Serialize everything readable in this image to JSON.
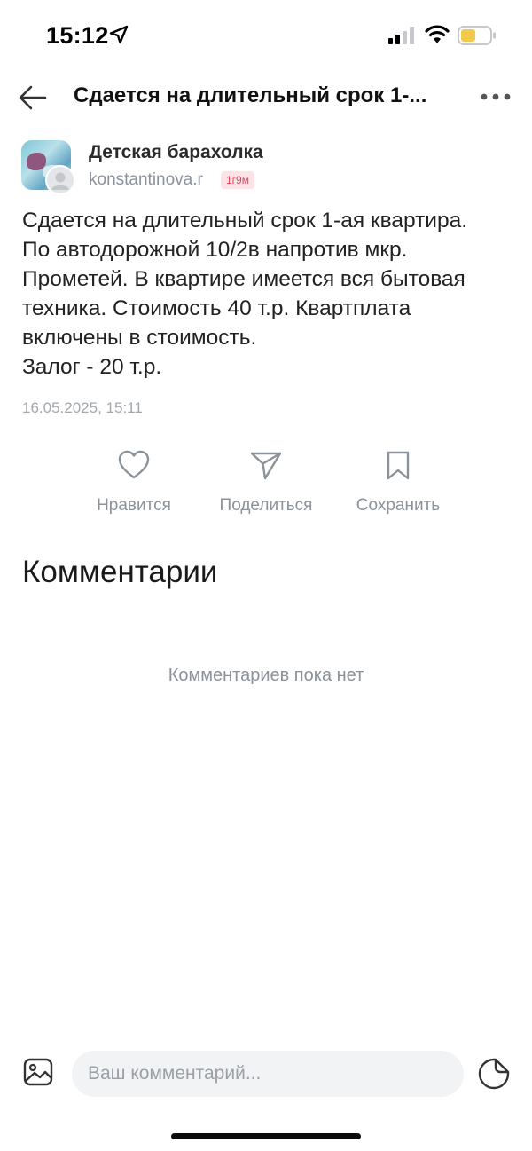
{
  "status_bar": {
    "time": "15:12",
    "icons": [
      "location-arrow-icon",
      "signal-icon",
      "wifi-icon",
      "battery-icon"
    ],
    "battery_color": "#f2c94c"
  },
  "header": {
    "title": "Сдается на длительный срок 1-...",
    "back_icon": "arrow-left-icon",
    "more_icon": "more-dots-icon"
  },
  "author": {
    "group_name": "Детская барахолка",
    "user_name": "konstantinova.r",
    "age": "1г9м"
  },
  "post": {
    "lines": [
      "Сдается на длительный срок 1-ая квартира.",
      "По автодорожной 10/2в напротив мкр.",
      "Прометей. В квартире имеется вся бытовая",
      "техника. Стоимость 40 т.р. Квартплата",
      "включены в стоимость.",
      "Залог - 20 т.р."
    ],
    "date": "16.05.2025, 15:11"
  },
  "actions": {
    "like": "Нравится",
    "share": "Поделиться",
    "save": "Сохранить"
  },
  "comments": {
    "title": "Комментарии",
    "empty": "Комментариев пока нет"
  },
  "composer": {
    "placeholder": "Ваш комментарий..."
  },
  "colors": {
    "muted": "#8b9299",
    "badge_bg": "#fde3e6",
    "badge_text": "#e0455f",
    "input_bg": "#f2f3f5"
  }
}
